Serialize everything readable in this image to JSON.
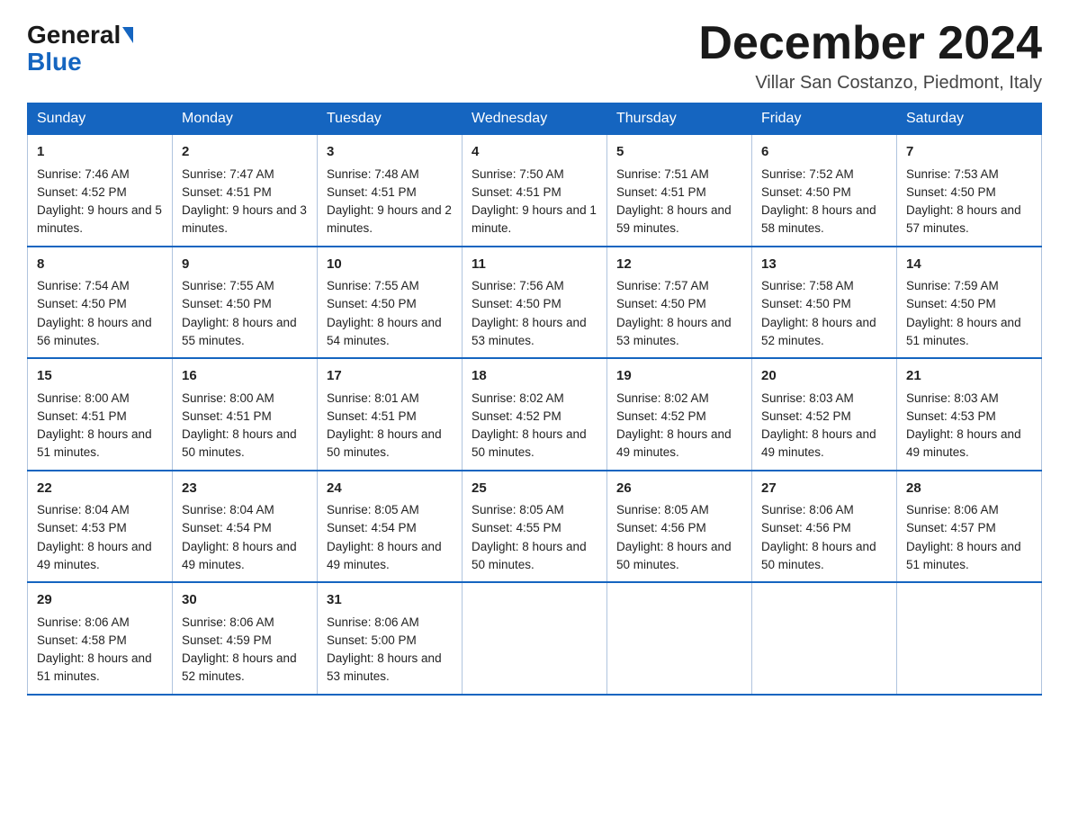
{
  "header": {
    "logo_general": "General",
    "logo_blue": "Blue",
    "month_title": "December 2024",
    "location": "Villar San Costanzo, Piedmont, Italy"
  },
  "days_of_week": [
    "Sunday",
    "Monday",
    "Tuesday",
    "Wednesday",
    "Thursday",
    "Friday",
    "Saturday"
  ],
  "weeks": [
    [
      {
        "day": "1",
        "sunrise": "7:46 AM",
        "sunset": "4:52 PM",
        "daylight": "9 hours and 5 minutes."
      },
      {
        "day": "2",
        "sunrise": "7:47 AM",
        "sunset": "4:51 PM",
        "daylight": "9 hours and 3 minutes."
      },
      {
        "day": "3",
        "sunrise": "7:48 AM",
        "sunset": "4:51 PM",
        "daylight": "9 hours and 2 minutes."
      },
      {
        "day": "4",
        "sunrise": "7:50 AM",
        "sunset": "4:51 PM",
        "daylight": "9 hours and 1 minute."
      },
      {
        "day": "5",
        "sunrise": "7:51 AM",
        "sunset": "4:51 PM",
        "daylight": "8 hours and 59 minutes."
      },
      {
        "day": "6",
        "sunrise": "7:52 AM",
        "sunset": "4:50 PM",
        "daylight": "8 hours and 58 minutes."
      },
      {
        "day": "7",
        "sunrise": "7:53 AM",
        "sunset": "4:50 PM",
        "daylight": "8 hours and 57 minutes."
      }
    ],
    [
      {
        "day": "8",
        "sunrise": "7:54 AM",
        "sunset": "4:50 PM",
        "daylight": "8 hours and 56 minutes."
      },
      {
        "day": "9",
        "sunrise": "7:55 AM",
        "sunset": "4:50 PM",
        "daylight": "8 hours and 55 minutes."
      },
      {
        "day": "10",
        "sunrise": "7:55 AM",
        "sunset": "4:50 PM",
        "daylight": "8 hours and 54 minutes."
      },
      {
        "day": "11",
        "sunrise": "7:56 AM",
        "sunset": "4:50 PM",
        "daylight": "8 hours and 53 minutes."
      },
      {
        "day": "12",
        "sunrise": "7:57 AM",
        "sunset": "4:50 PM",
        "daylight": "8 hours and 53 minutes."
      },
      {
        "day": "13",
        "sunrise": "7:58 AM",
        "sunset": "4:50 PM",
        "daylight": "8 hours and 52 minutes."
      },
      {
        "day": "14",
        "sunrise": "7:59 AM",
        "sunset": "4:50 PM",
        "daylight": "8 hours and 51 minutes."
      }
    ],
    [
      {
        "day": "15",
        "sunrise": "8:00 AM",
        "sunset": "4:51 PM",
        "daylight": "8 hours and 51 minutes."
      },
      {
        "day": "16",
        "sunrise": "8:00 AM",
        "sunset": "4:51 PM",
        "daylight": "8 hours and 50 minutes."
      },
      {
        "day": "17",
        "sunrise": "8:01 AM",
        "sunset": "4:51 PM",
        "daylight": "8 hours and 50 minutes."
      },
      {
        "day": "18",
        "sunrise": "8:02 AM",
        "sunset": "4:52 PM",
        "daylight": "8 hours and 50 minutes."
      },
      {
        "day": "19",
        "sunrise": "8:02 AM",
        "sunset": "4:52 PM",
        "daylight": "8 hours and 49 minutes."
      },
      {
        "day": "20",
        "sunrise": "8:03 AM",
        "sunset": "4:52 PM",
        "daylight": "8 hours and 49 minutes."
      },
      {
        "day": "21",
        "sunrise": "8:03 AM",
        "sunset": "4:53 PM",
        "daylight": "8 hours and 49 minutes."
      }
    ],
    [
      {
        "day": "22",
        "sunrise": "8:04 AM",
        "sunset": "4:53 PM",
        "daylight": "8 hours and 49 minutes."
      },
      {
        "day": "23",
        "sunrise": "8:04 AM",
        "sunset": "4:54 PM",
        "daylight": "8 hours and 49 minutes."
      },
      {
        "day": "24",
        "sunrise": "8:05 AM",
        "sunset": "4:54 PM",
        "daylight": "8 hours and 49 minutes."
      },
      {
        "day": "25",
        "sunrise": "8:05 AM",
        "sunset": "4:55 PM",
        "daylight": "8 hours and 50 minutes."
      },
      {
        "day": "26",
        "sunrise": "8:05 AM",
        "sunset": "4:56 PM",
        "daylight": "8 hours and 50 minutes."
      },
      {
        "day": "27",
        "sunrise": "8:06 AM",
        "sunset": "4:56 PM",
        "daylight": "8 hours and 50 minutes."
      },
      {
        "day": "28",
        "sunrise": "8:06 AM",
        "sunset": "4:57 PM",
        "daylight": "8 hours and 51 minutes."
      }
    ],
    [
      {
        "day": "29",
        "sunrise": "8:06 AM",
        "sunset": "4:58 PM",
        "daylight": "8 hours and 51 minutes."
      },
      {
        "day": "30",
        "sunrise": "8:06 AM",
        "sunset": "4:59 PM",
        "daylight": "8 hours and 52 minutes."
      },
      {
        "day": "31",
        "sunrise": "8:06 AM",
        "sunset": "5:00 PM",
        "daylight": "8 hours and 53 minutes."
      },
      null,
      null,
      null,
      null
    ]
  ]
}
